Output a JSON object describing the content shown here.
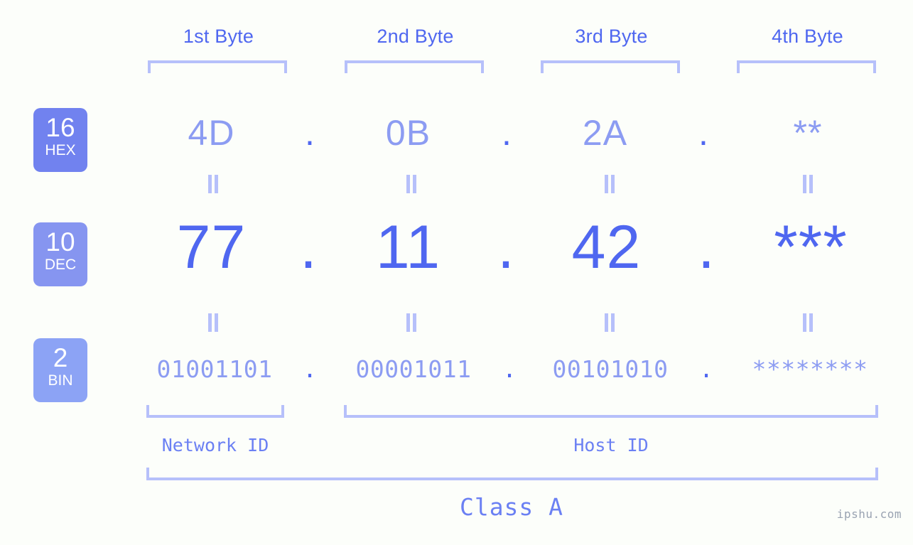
{
  "background_color": "#fcfefa",
  "accent_colors": {
    "strong_blue": "#4f67f0",
    "mid_blue": "#6b80f3",
    "light_blue": "#8c9cf2",
    "bracket_blue": "#b6c0fa",
    "badge_hex": "#7182ef",
    "badge_dec": "#8695f0",
    "badge_bin": "#8ca3f5",
    "watermark": "#9aa3b2"
  },
  "byte_headers": [
    {
      "label": "1st Byte"
    },
    {
      "label": "2nd Byte"
    },
    {
      "label": "3rd Byte"
    },
    {
      "label": "4th Byte"
    }
  ],
  "bases": [
    {
      "number": "16",
      "abbr": "HEX"
    },
    {
      "number": "10",
      "abbr": "DEC"
    },
    {
      "number": "2",
      "abbr": "BIN"
    }
  ],
  "rows": {
    "hex": {
      "base_number": "16",
      "base_abbr": "HEX",
      "values": [
        "4D",
        "0B",
        "2A",
        "**"
      ],
      "separators": [
        ".",
        ".",
        "."
      ]
    },
    "dec": {
      "base_number": "10",
      "base_abbr": "DEC",
      "values": [
        "77",
        "11",
        "42",
        "***"
      ],
      "separators": [
        ".",
        ".",
        "."
      ]
    },
    "bin": {
      "base_number": "2",
      "base_abbr": "BIN",
      "values": [
        "01001101",
        "00001011",
        "00101010",
        "********"
      ],
      "separators": [
        ".",
        ".",
        "."
      ]
    }
  },
  "equivalence_marks": {
    "glyph": "=",
    "count_per_gap": 4,
    "gaps": 2
  },
  "id_labels": {
    "network": "Network ID",
    "host": "Host ID"
  },
  "class_label": "Class A",
  "watermark": "ipshu.com"
}
